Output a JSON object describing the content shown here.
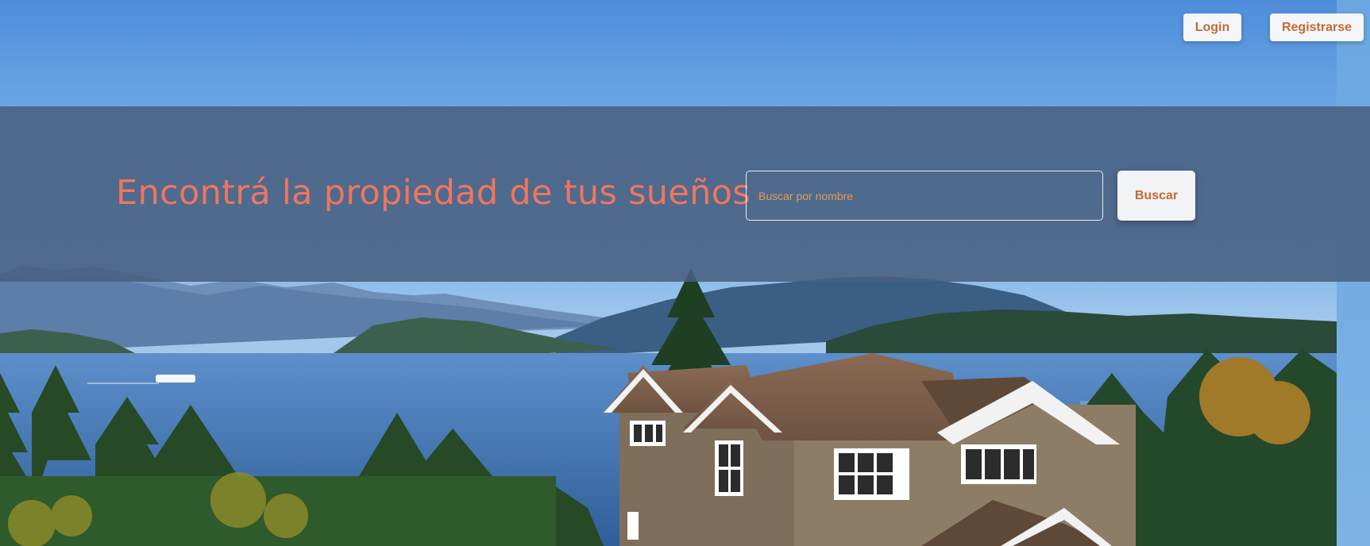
{
  "nav": {
    "login_label": "Login",
    "register_label": "Registrarse"
  },
  "hero": {
    "title": "Encontrá la propiedad de tus sueños",
    "search_placeholder": "Buscar por nombre",
    "search_button_label": "Buscar"
  },
  "colors": {
    "accent": "#c46a32",
    "title": "#f0755e",
    "hero_overlay": "#486080"
  }
}
